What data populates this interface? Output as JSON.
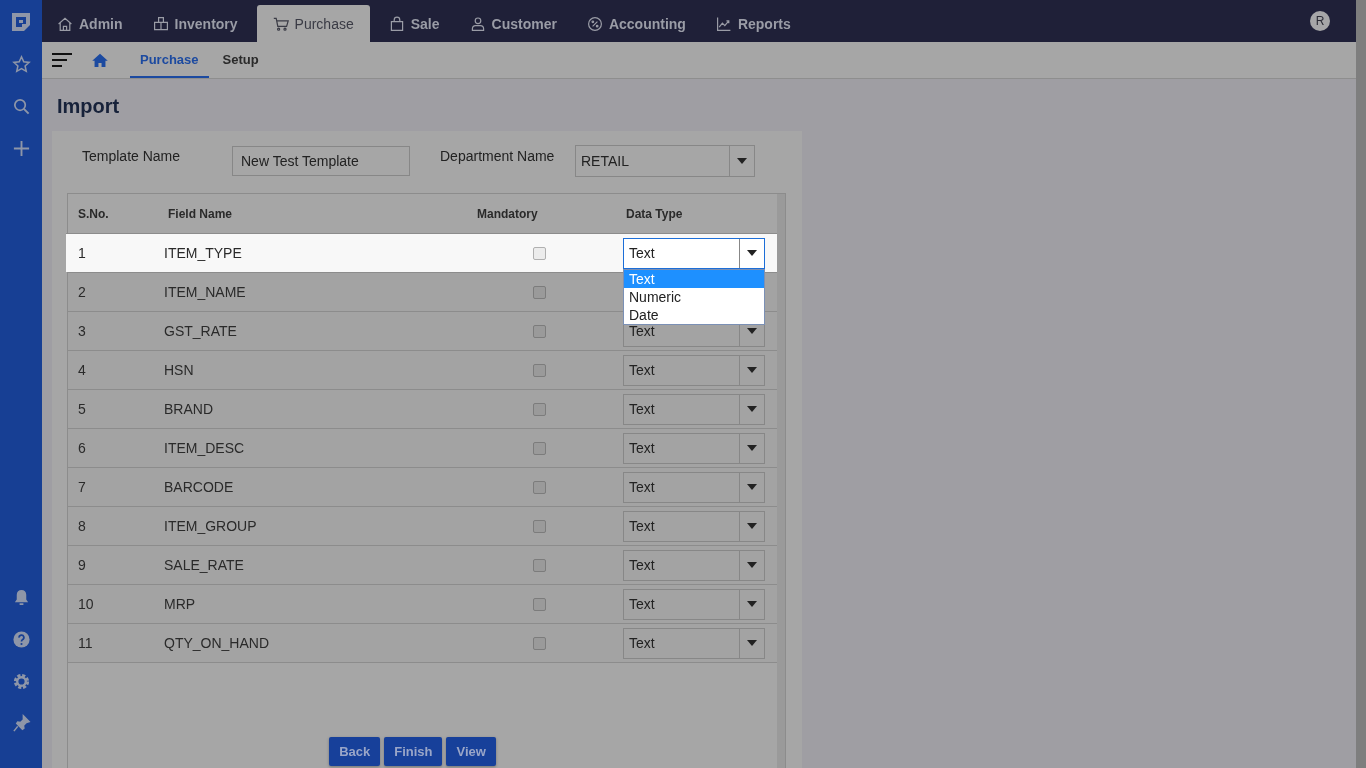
{
  "top_nav": {
    "avatar": "R",
    "tabs": [
      {
        "label": "Admin",
        "selected": false
      },
      {
        "label": "Inventory",
        "selected": false
      },
      {
        "label": "Purchase",
        "selected": true
      },
      {
        "label": "Sale",
        "selected": false
      },
      {
        "label": "Customer",
        "selected": false
      },
      {
        "label": "Accounting",
        "selected": false
      },
      {
        "label": "Reports",
        "selected": false
      }
    ]
  },
  "sub_nav": {
    "tabs": [
      {
        "label": "Purchase",
        "selected": true
      },
      {
        "label": "Setup",
        "selected": false
      }
    ]
  },
  "page_title": "Import",
  "form": {
    "template_name": {
      "label": "Template Name",
      "value": "New Test Template"
    },
    "department_name": {
      "label": "Department Name",
      "value": "RETAIL"
    }
  },
  "table": {
    "columns": [
      "S.No.",
      "Field Name",
      "Mandatory",
      "Data Type"
    ],
    "rows": [
      {
        "sno": "1",
        "field": "ITEM_TYPE",
        "mandatory": false,
        "focused": true,
        "data_type": "Text",
        "dropdown": [
          {
            "label": "Text",
            "selected": true
          },
          {
            "label": "Numeric",
            "selected": false
          },
          {
            "label": "Date",
            "selected": false
          }
        ]
      },
      {
        "sno": "2",
        "field": "ITEM_NAME",
        "mandatory": false,
        "focused": false
      },
      {
        "sno": "3",
        "field": "GST_RATE",
        "mandatory": false,
        "focused": false,
        "data_type": "Text"
      },
      {
        "sno": "4",
        "field": "HSN",
        "mandatory": false,
        "focused": false,
        "data_type": "Text"
      },
      {
        "sno": "5",
        "field": "BRAND",
        "mandatory": false,
        "focused": false,
        "data_type": "Text"
      },
      {
        "sno": "6",
        "field": "ITEM_DESC",
        "mandatory": false,
        "focused": false,
        "data_type": "Text"
      },
      {
        "sno": "7",
        "field": "BARCODE",
        "mandatory": false,
        "focused": false,
        "data_type": "Text"
      },
      {
        "sno": "8",
        "field": "ITEM_GROUP",
        "mandatory": false,
        "focused": false,
        "data_type": "Text"
      },
      {
        "sno": "9",
        "field": "SALE_RATE",
        "mandatory": false,
        "focused": false,
        "data_type": "Text"
      },
      {
        "sno": "10",
        "field": "MRP",
        "mandatory": false,
        "focused": false,
        "data_type": "Text"
      },
      {
        "sno": "11",
        "field": "QTY_ON_HAND",
        "mandatory": false,
        "focused": false,
        "data_type": "Text"
      }
    ]
  },
  "buttons": [
    "Back",
    "Finish",
    "View"
  ]
}
